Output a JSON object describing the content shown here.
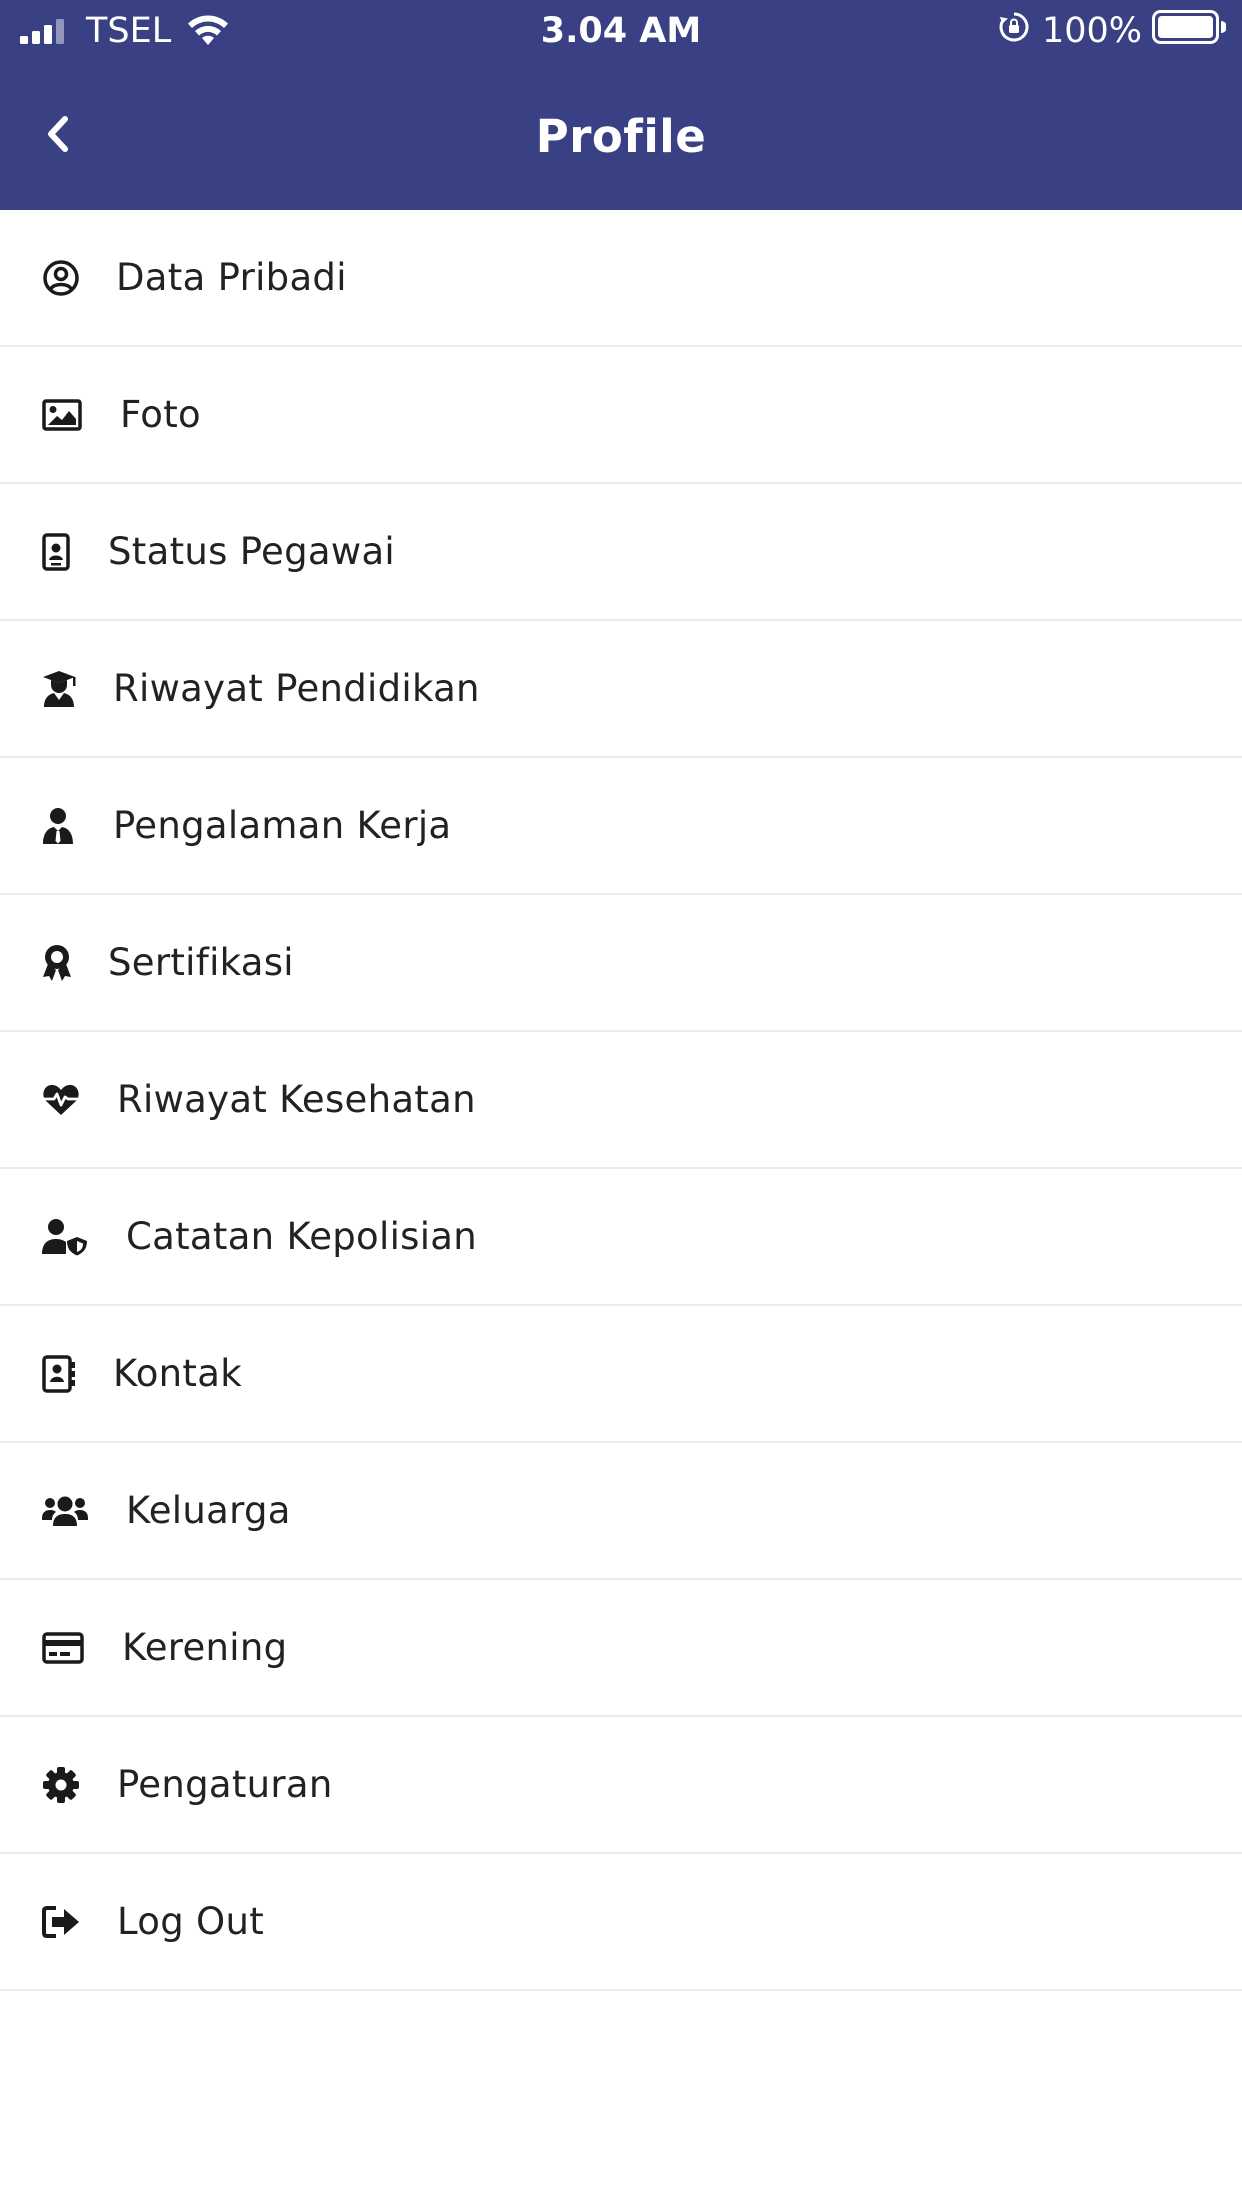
{
  "status_bar": {
    "carrier": "TSEL",
    "time": "3.04 AM",
    "battery": "100%"
  },
  "header": {
    "title": "Profile"
  },
  "menu": [
    {
      "label": "Data Pribadi",
      "icon": "user-circle-icon"
    },
    {
      "label": "Foto",
      "icon": "image-icon"
    },
    {
      "label": "Status Pegawai",
      "icon": "id-badge-icon"
    },
    {
      "label": "Riwayat Pendidikan",
      "icon": "graduate-icon"
    },
    {
      "label": "Pengalaman Kerja",
      "icon": "user-tie-icon"
    },
    {
      "label": "Sertifikasi",
      "icon": "award-icon"
    },
    {
      "label": "Riwayat Kesehatan",
      "icon": "heartbeat-icon"
    },
    {
      "label": "Catatan Kepolisian",
      "icon": "user-shield-icon"
    },
    {
      "label": "Kontak",
      "icon": "address-book-icon"
    },
    {
      "label": "Keluarga",
      "icon": "users-icon"
    },
    {
      "label": "Kerening",
      "icon": "credit-card-icon"
    },
    {
      "label": "Pengaturan",
      "icon": "cog-icon"
    },
    {
      "label": "Log Out",
      "icon": "sign-out-icon"
    }
  ],
  "colors": {
    "header_bg": "#394084",
    "header_text": "#ffffff",
    "divider": "#ececec",
    "icon": "#1a1a1a"
  }
}
